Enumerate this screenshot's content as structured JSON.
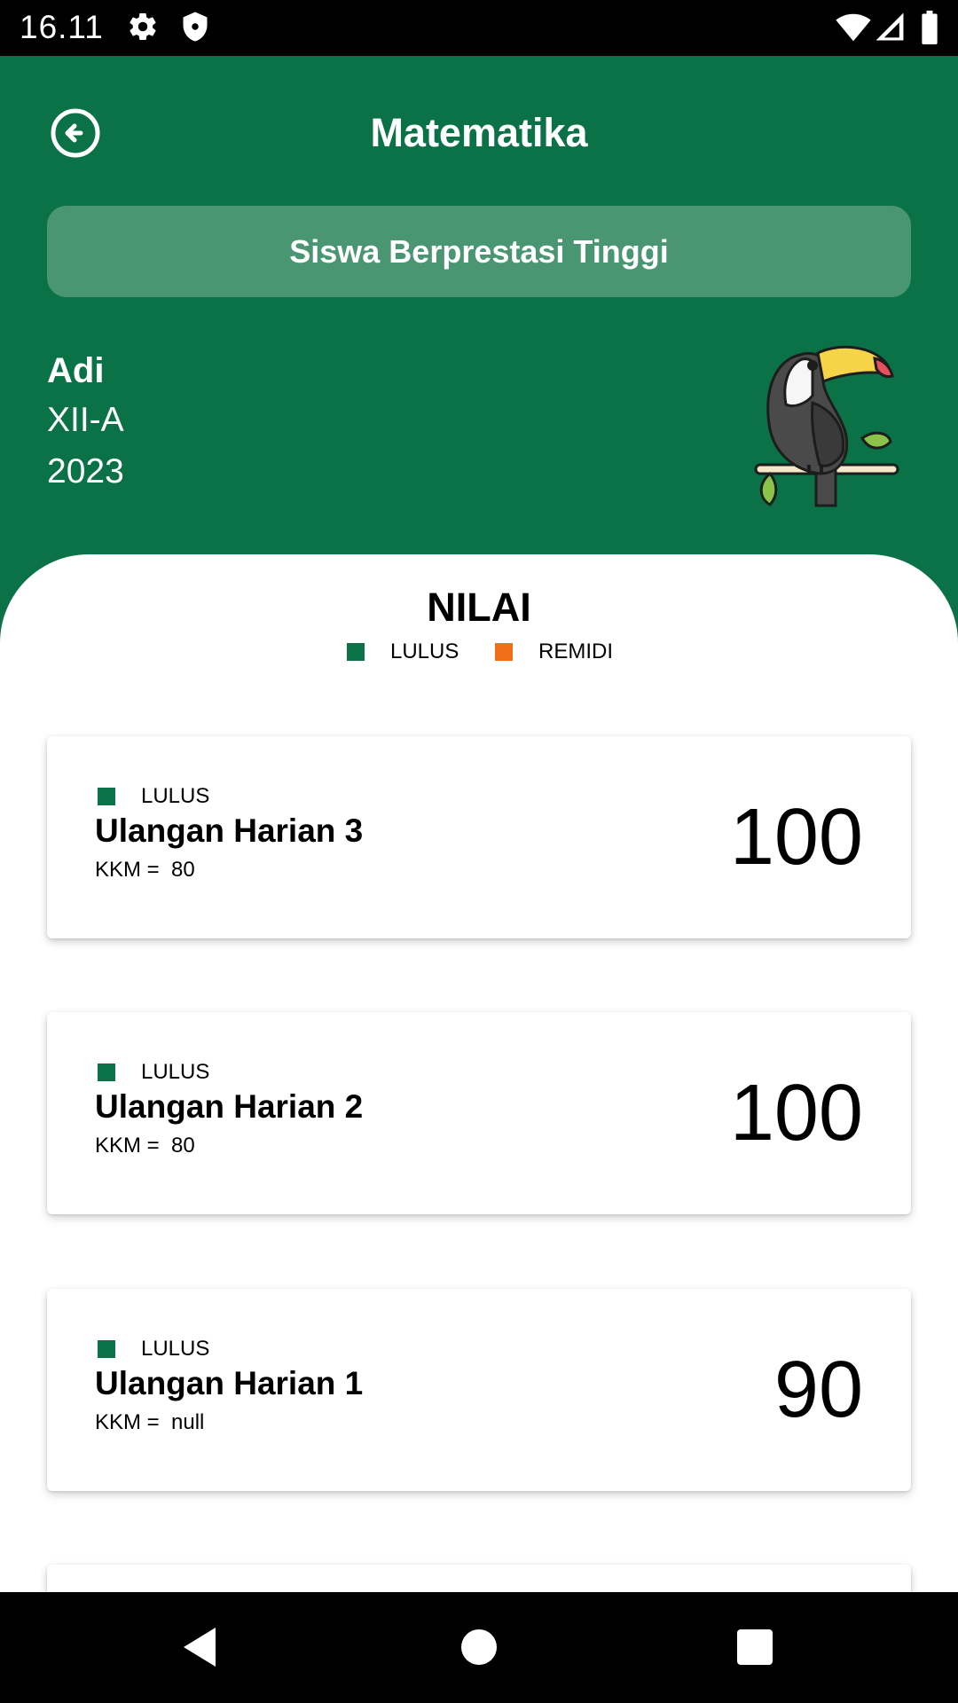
{
  "status_bar": {
    "time": "16.11",
    "icons": [
      "settings-icon",
      "shield-icon",
      "wifi-icon",
      "signal-icon",
      "battery-icon"
    ]
  },
  "header": {
    "title": "Matematika",
    "back_icon": "arrow-back-circle-icon",
    "banner_label": "Siswa Berprestasi Tinggi"
  },
  "student": {
    "name": "Adi",
    "class": "XII-A",
    "year": "2023",
    "mascot_icon": "toucan-icon"
  },
  "grades": {
    "title": "NILAI",
    "legend": [
      {
        "label": "LULUS",
        "color": "#0B7146"
      },
      {
        "label": "REMIDI",
        "color": "#F0701A"
      }
    ],
    "items": [
      {
        "status": "LULUS",
        "status_color": "#0B7146",
        "name": "Ulangan Harian 3",
        "kkm": "KKM =  80",
        "score": "100"
      },
      {
        "status": "LULUS",
        "status_color": "#0B7146",
        "name": "Ulangan Harian 2",
        "kkm": "KKM =  80",
        "score": "100"
      },
      {
        "status": "LULUS",
        "status_color": "#0B7146",
        "name": "Ulangan Harian 1",
        "kkm": "KKM =  null",
        "score": "90"
      }
    ]
  },
  "nav": {
    "back_icon": "triangle-back-icon",
    "home_icon": "circle-home-icon",
    "recents_icon": "square-recents-icon"
  },
  "colors": {
    "primary": "#0B7146",
    "banner": "#4A9673",
    "remidi": "#F0701A"
  }
}
